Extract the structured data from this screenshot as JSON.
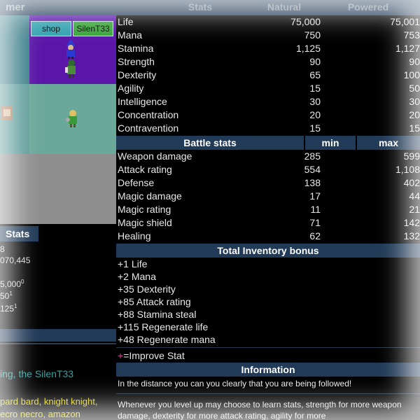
{
  "left": {
    "header_fragment": "mer",
    "shop_button": "shop",
    "user_button": "SilenT33",
    "stats_header": "Stats",
    "values": [
      "8",
      "070,445",
      "5,000",
      "0",
      "50",
      "1",
      "125",
      "1"
    ],
    "message": "ing, the SilenT33",
    "players": [
      "pard bard, knight knight,",
      "ecro necro, amazon"
    ]
  },
  "table": {
    "headers": {
      "stats": "Stats",
      "natural": "Natural",
      "powered": "Powered"
    },
    "stats": [
      {
        "label": "Life",
        "natural": "75,000",
        "powered": "75,001"
      },
      {
        "label": "Mana",
        "natural": "750",
        "powered": "753"
      },
      {
        "label": "Stamina",
        "natural": "1,125",
        "powered": "1,127"
      },
      {
        "label": "Strength",
        "natural": "90",
        "powered": "90"
      },
      {
        "label": "Dexterity",
        "natural": "65",
        "powered": "100"
      },
      {
        "label": "Agility",
        "natural": "15",
        "powered": "50"
      },
      {
        "label": "Intelligence",
        "natural": "30",
        "powered": "30"
      },
      {
        "label": "Concentration",
        "natural": "20",
        "powered": "20"
      },
      {
        "label": "Contravention",
        "natural": "15",
        "powered": "15"
      }
    ],
    "battle_header": {
      "title": "Battle stats",
      "min": "min",
      "max": "max"
    },
    "battle": [
      {
        "label": "Weapon damage",
        "min": "285",
        "max": "599"
      },
      {
        "label": "Attack rating",
        "min": "554",
        "max": "1,108"
      },
      {
        "label": "Defense",
        "min": "138",
        "max": "402"
      },
      {
        "label": "Magic damage",
        "min": "17",
        "max": "44"
      },
      {
        "label": "Magic rating",
        "min": "11",
        "max": "21"
      },
      {
        "label": "Magic shield",
        "min": "71",
        "max": "142"
      },
      {
        "label": "Healing",
        "min": "62",
        "max": "132"
      }
    ],
    "inventory_header": "Total Inventory bonus",
    "inventory": [
      "+1 Life",
      "+2 Mana",
      "+35 Dexterity",
      "+85 Attack rating",
      "+88 Stamina steal",
      "+115 Regenerate life",
      "+48 Regenerate mana"
    ],
    "improve_symbol": "+",
    "improve_text": "=Improve Stat",
    "information_header": "Information",
    "info_text": "In the distance you can you clearly that you are being followed!",
    "level_text": "Whenever you level up may choose to learn stats, strength for more weapon damage, dexterity for more attack rating, agility for more"
  },
  "colors": {
    "header_bg": "#203a57",
    "purple_cell": "#5a16a8",
    "teal_cell": "#6aa89a",
    "gray_cell": "#8e8e8e",
    "player_text": "#e0d400",
    "message_text": "#3aa0a0"
  }
}
